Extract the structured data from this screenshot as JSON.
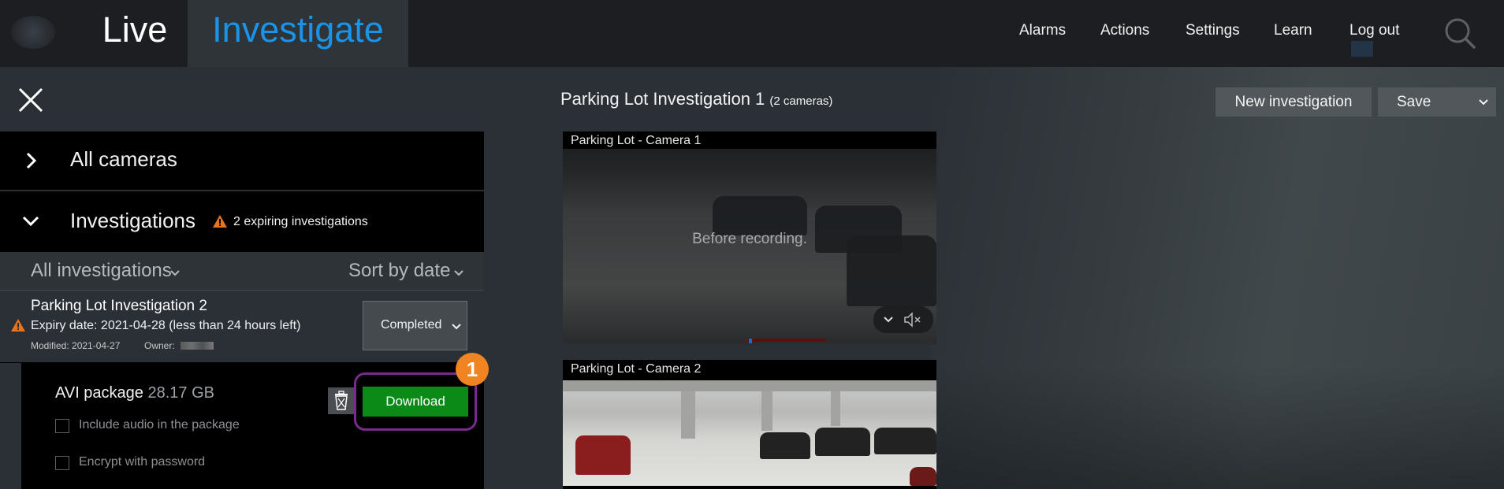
{
  "top_nav": {
    "tabs": [
      {
        "label": "Live",
        "active": false
      },
      {
        "label": "Investigate",
        "active": true
      }
    ],
    "menu": [
      "Alarms",
      "Actions",
      "Settings",
      "Learn",
      "Log out"
    ],
    "active_tab_color": "#1a93e8"
  },
  "sidebar": {
    "all_cameras": "All cameras",
    "investigations": "Investigations",
    "expiring_warning": "2 expiring investigations",
    "filter_label": "All investigations",
    "sort_label": "Sort by date",
    "item": {
      "title": "Parking Lot Investigation 2",
      "expiry": "Expiry date: 2021-04-28 (less than 24 hours left)",
      "modified": "Modified: 2021-04-27",
      "owner_label": "Owner:",
      "status": "Completed"
    },
    "package": {
      "name": "AVI package",
      "size": "28.17 GB",
      "download_label": "Download",
      "include_audio_label": "Include audio in the package",
      "encrypt_label": "Encrypt with password",
      "callout_number": "1"
    }
  },
  "main": {
    "investigation_title": "Parking Lot Investigation 1",
    "camera_count": "(2 cameras)",
    "new_investigation_label": "New investigation",
    "save_label": "Save",
    "cameras": [
      {
        "label": "Parking Lot - Camera 1",
        "overlay": "Before recording."
      },
      {
        "label": "Parking Lot - Camera 2"
      }
    ]
  },
  "colors": {
    "download_green": "#0c8a18",
    "callout_orange": "#f08420",
    "callout_ring": "#7a2a8c",
    "warning_orange": "#e8741e"
  }
}
